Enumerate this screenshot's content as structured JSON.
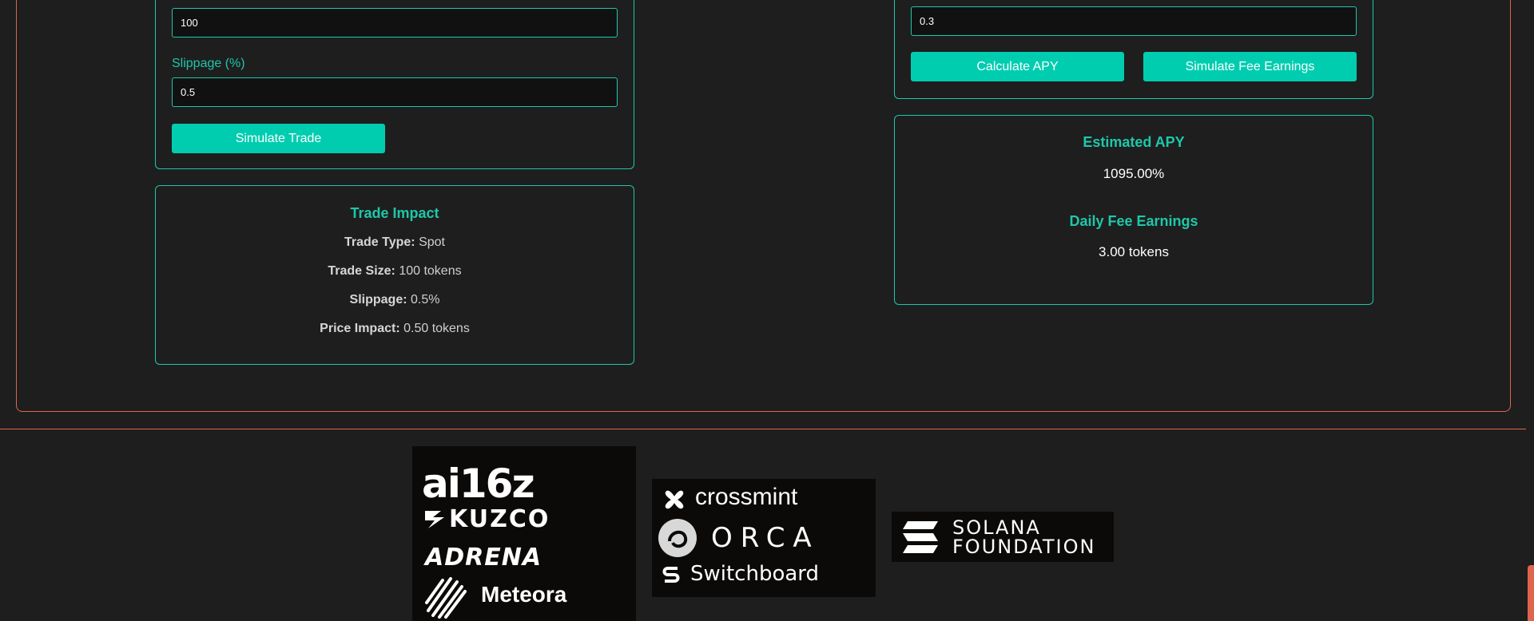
{
  "trade": {
    "amount_value": "100",
    "slippage_label": "Slippage (%)",
    "slippage_value": "0.5",
    "simulate_button": "Simulate Trade"
  },
  "trade_impact": {
    "title": "Trade Impact",
    "rows": [
      {
        "label": "Trade Type:",
        "value": " Spot"
      },
      {
        "label": "Trade Size:",
        "value": " 100 tokens"
      },
      {
        "label": "Slippage:",
        "value": " 0.5%"
      },
      {
        "label": "Price Impact:",
        "value": " 0.50 tokens"
      }
    ]
  },
  "liquidity": {
    "fee_value": "0.3",
    "calc_apy_button": "Calculate APY",
    "simulate_fee_button": "Simulate Fee Earnings"
  },
  "results": {
    "apy_title": "Estimated APY",
    "apy_value": "1095.00%",
    "fee_title": "Daily Fee Earnings",
    "fee_value": "3.00 tokens"
  },
  "sponsors": {
    "group1": [
      "ai16z",
      "KUZCO",
      "ADRENA",
      "Meteora"
    ],
    "group2": [
      "crossmint",
      "ORCA",
      "Switchboard"
    ],
    "group3": [
      "SOLANA",
      "FOUNDATION"
    ]
  }
}
